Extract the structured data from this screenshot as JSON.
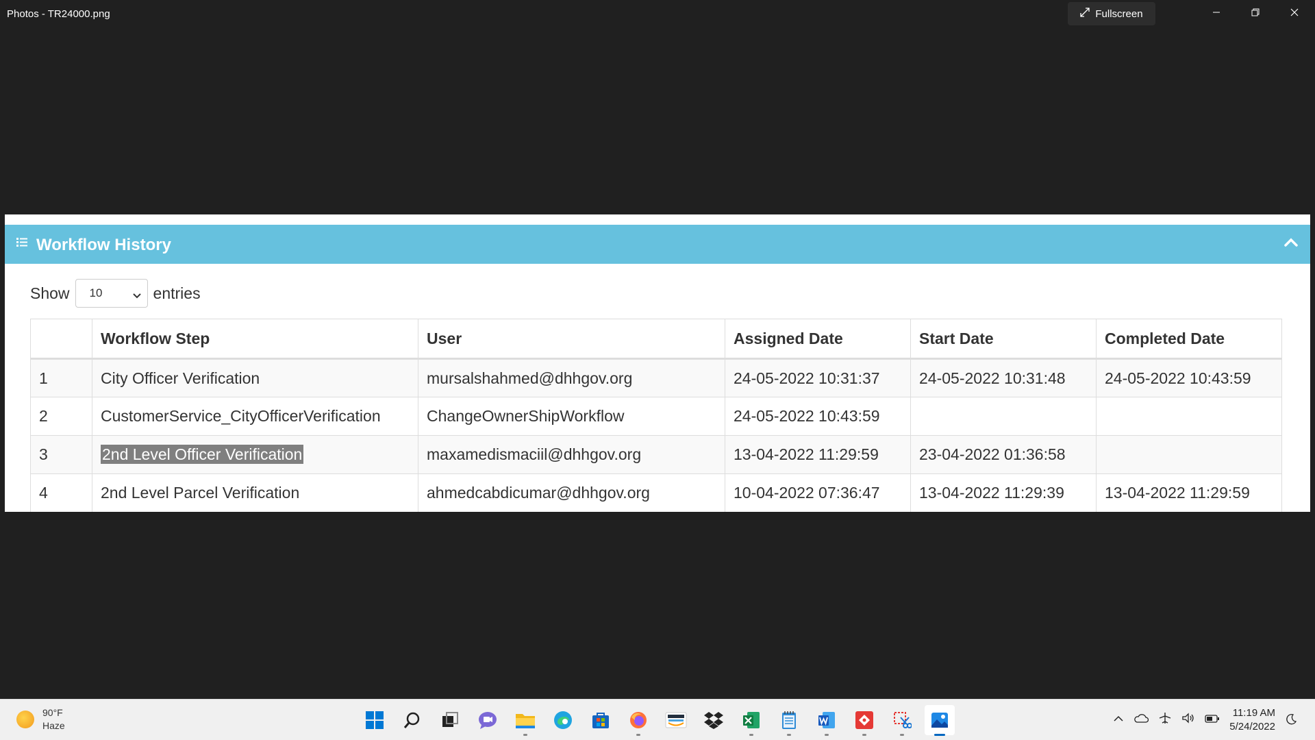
{
  "window": {
    "title": "Photos - TR24000.png",
    "fullscreen_label": "Fullscreen"
  },
  "panel": {
    "title": "Workflow History",
    "show_label": "Show",
    "entries_value": "10",
    "entries_label": "entries"
  },
  "table": {
    "headers": [
      "",
      "Workflow Step",
      "User",
      "Assigned Date",
      "Start Date",
      "Completed Date"
    ],
    "rows": [
      [
        "1",
        "City Officer Verification",
        "mursalshahmed@dhhgov.org",
        "24-05-2022 10:31:37",
        "24-05-2022 10:31:48",
        "24-05-2022 10:43:59"
      ],
      [
        "2",
        "CustomerService_CityOfficerVerification",
        "ChangeOwnerShipWorkflow",
        "24-05-2022 10:43:59",
        "",
        ""
      ],
      [
        "3",
        "2nd Level Officer Verification",
        "maxamedismaciil@dhhgov.org",
        "13-04-2022 11:29:59",
        "23-04-2022 01:36:58",
        ""
      ],
      [
        "4",
        "2nd Level Parcel Verification",
        "ahmedcabdicumar@dhhgov.org",
        "10-04-2022 07:36:47",
        "13-04-2022 11:29:39",
        "13-04-2022 11:29:59"
      ]
    ]
  },
  "taskbar": {
    "weather_temp": "90°F",
    "weather_desc": "Haze",
    "time": "11:19 AM",
    "date": "5/24/2022",
    "apps": [
      "start-icon",
      "search-icon",
      "task-view-icon",
      "chat-icon",
      "file-explorer-icon",
      "edge-icon",
      "store-icon",
      "firefox-icon",
      "amazon-icon",
      "dropbox-icon",
      "excel-icon",
      "notepad-icon",
      "word-icon",
      "git-icon",
      "snipping-tool-icon",
      "photos-icon"
    ]
  },
  "colors": {
    "panel_header": "#66c1de",
    "background": "#202020",
    "selection": "#7f7f7f"
  }
}
